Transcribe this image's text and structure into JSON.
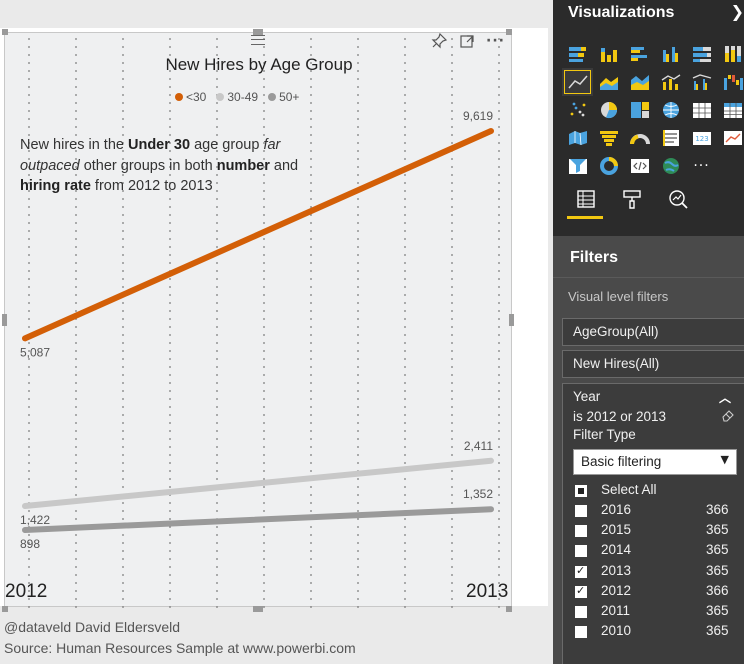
{
  "report": {
    "chart_title": "New Hires by Age Group",
    "annotation_parts": [
      {
        "text": "New hires in the ",
        "style": "normal"
      },
      {
        "text": "Under 30",
        "style": "bold"
      },
      {
        "text": " age group ",
        "style": "normal"
      },
      {
        "text": "far outpaced",
        "style": "italic"
      },
      {
        "text": " other groups in both ",
        "style": "normal"
      },
      {
        "text": "number",
        "style": "bold"
      },
      {
        "text": " and ",
        "style": "normal"
      },
      {
        "text": "hiring rate",
        "style": "bold"
      },
      {
        "text": " from 2012 to 2013",
        "style": "normal"
      }
    ],
    "credit_line": "@dataveld  David Eldersveld",
    "source_line": "Source: Human Resources Sample at www.powerbi.com",
    "header_icons": [
      "pin-icon",
      "focus-mode-icon",
      "more-options-icon"
    ]
  },
  "chart_data": {
    "type": "line",
    "title": "New Hires by Age Group",
    "categories": [
      "2012",
      "2013"
    ],
    "series": [
      {
        "name": "<30",
        "values": [
          5087,
          9619
        ],
        "labels": [
          "5,087",
          "9,619"
        ],
        "color": "#d35f07"
      },
      {
        "name": "30-49",
        "values": [
          1422,
          2411
        ],
        "labels": [
          "1,422",
          "2,411"
        ],
        "color": "#c8c8c8"
      },
      {
        "name": "50+",
        "values": [
          898,
          1352
        ],
        "labels": [
          "898",
          "1,352"
        ],
        "color": "#9a9a9a"
      }
    ],
    "legend_position": "top-center",
    "gridlines": false
  },
  "panel": {
    "viz_title": "Visualizations",
    "viz_icons": [
      "stacked-bar-icon",
      "stacked-column-icon",
      "clustered-bar-icon",
      "clustered-column-icon",
      "100-stacked-bar-icon",
      "100-stacked-column-icon",
      "line-chart-icon",
      "area-chart-icon",
      "stacked-area-icon",
      "line-column-icon",
      "line-clustered-column-icon",
      "waterfall-icon",
      "scatter-icon",
      "pie-icon",
      "treemap-icon",
      "map-icon",
      "table-icon",
      "matrix-icon",
      "filled-map-icon",
      "funnel-icon",
      "gauge-icon",
      "multi-row-card-icon",
      "card-icon",
      "kpi-icon",
      "slicer-icon",
      "donut-icon",
      "r-script-icon",
      "globe-map-icon",
      "more-visuals-icon"
    ],
    "selected_viz": "line-chart-icon",
    "pane_tabs": [
      "fields-tab-icon",
      "format-tab-icon",
      "analytics-tab-icon"
    ],
    "filters_title": "Filters",
    "visual_filters_label": "Visual level filters",
    "filters": [
      {
        "label": "AgeGroup(All)"
      },
      {
        "label": "New Hires(All)"
      }
    ],
    "year_filter": {
      "field": "Year",
      "condition": "is 2012 or 2013",
      "filter_type_label": "Filter Type",
      "filter_type_value": "Basic filtering",
      "select_all": "Select All",
      "options": [
        {
          "year": "2016",
          "count": "366",
          "checked": false
        },
        {
          "year": "2015",
          "count": "365",
          "checked": false
        },
        {
          "year": "2014",
          "count": "365",
          "checked": false
        },
        {
          "year": "2013",
          "count": "365",
          "checked": true
        },
        {
          "year": "2012",
          "count": "366",
          "checked": true
        },
        {
          "year": "2011",
          "count": "365",
          "checked": false
        },
        {
          "year": "2010",
          "count": "365",
          "checked": false
        }
      ]
    }
  }
}
